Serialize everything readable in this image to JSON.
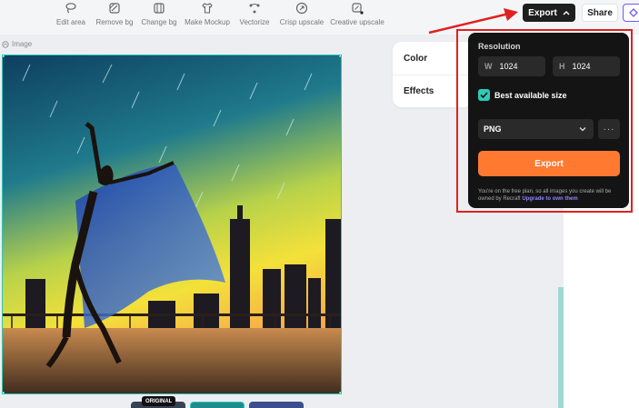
{
  "toolbar": {
    "tools": [
      {
        "label": "Edit area",
        "icon": "lasso-icon"
      },
      {
        "label": "Remove bg",
        "icon": "remove-bg-icon"
      },
      {
        "label": "Change bg",
        "icon": "change-bg-icon"
      },
      {
        "label": "Make Mockup",
        "icon": "tshirt-icon"
      },
      {
        "label": "Vectorize",
        "icon": "vector-nodes-icon"
      },
      {
        "label": "Crisp upscale",
        "icon": "upscale-icon"
      },
      {
        "label": "Creative upscale",
        "icon": "sparkle-upscale-icon"
      }
    ],
    "export_label": "Export",
    "share_label": "Share"
  },
  "canvas": {
    "image_tag": "Image",
    "original_badge": "ORIGINAL"
  },
  "side_panel": {
    "items": [
      "Color",
      "Effects"
    ]
  },
  "export_popover": {
    "title": "Resolution",
    "width_key": "W",
    "width_value": "1024",
    "height_key": "H",
    "height_value": "1024",
    "best_size_label": "Best available size",
    "best_size_checked": true,
    "format_value": "PNG",
    "more_label": "···",
    "export_button": "Export",
    "note_text": "You're on the free plan, so all images you create will be owned by Recraft",
    "note_link": "Upgrade to own them"
  },
  "colors": {
    "accent_orange": "#ff7a30",
    "accent_teal": "#2ecbb7",
    "highlight_red": "#e02020",
    "link_purple": "#8f86ff"
  }
}
